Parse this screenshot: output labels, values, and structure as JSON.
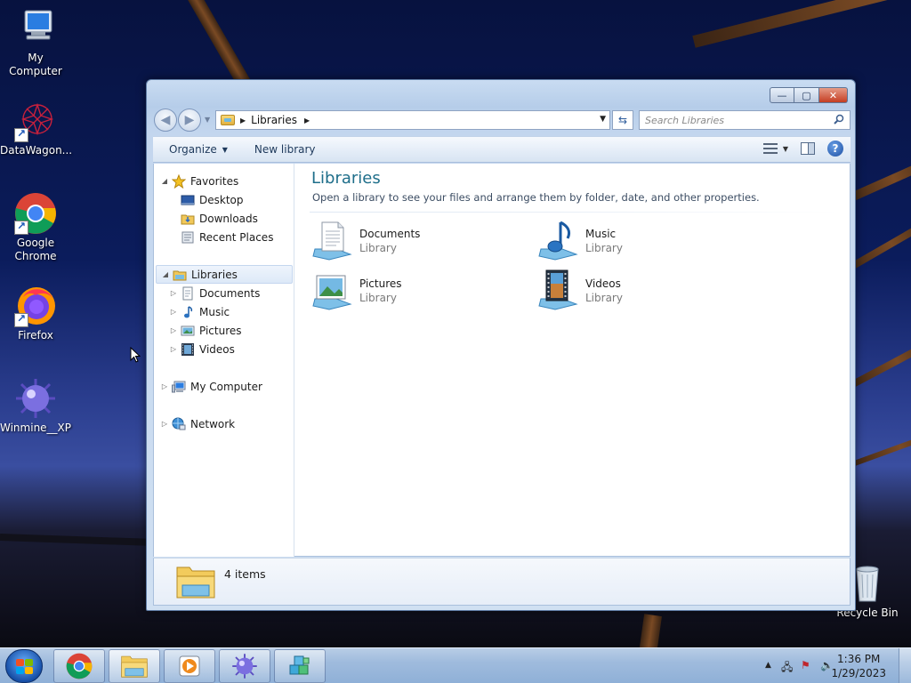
{
  "desktop": {
    "icons": [
      {
        "label": "My Computer"
      },
      {
        "label": "DataWagon..."
      },
      {
        "label": "Google Chrome"
      },
      {
        "label": "Firefox"
      },
      {
        "label": "Winmine__XP"
      },
      {
        "label": "Recycle Bin"
      }
    ]
  },
  "window": {
    "controls": {
      "minimize": "—",
      "maximize": "▢",
      "close": "✕"
    },
    "address": {
      "crumb": "Libraries"
    },
    "search": {
      "placeholder": "Search Libraries"
    },
    "toolbar": {
      "organize": "Organize",
      "new_library": "New library"
    },
    "nav_pane": {
      "favorites": "Favorites",
      "favorites_items": [
        "Desktop",
        "Downloads",
        "Recent Places"
      ],
      "libraries": "Libraries",
      "libraries_items": [
        "Documents",
        "Music",
        "Pictures",
        "Videos"
      ],
      "computer": "My Computer",
      "network": "Network"
    },
    "content": {
      "title": "Libraries",
      "subtitle": "Open a library to see your files and arrange them by folder, date, and other properties.",
      "libraries": [
        {
          "name": "Documents",
          "kind": "Library"
        },
        {
          "name": "Music",
          "kind": "Library"
        },
        {
          "name": "Pictures",
          "kind": "Library"
        },
        {
          "name": "Videos",
          "kind": "Library"
        }
      ]
    },
    "details": {
      "count": "4 items"
    }
  },
  "taskbar": {
    "clock": {
      "time": "1:36 PM",
      "date": "1/29/2023"
    }
  }
}
